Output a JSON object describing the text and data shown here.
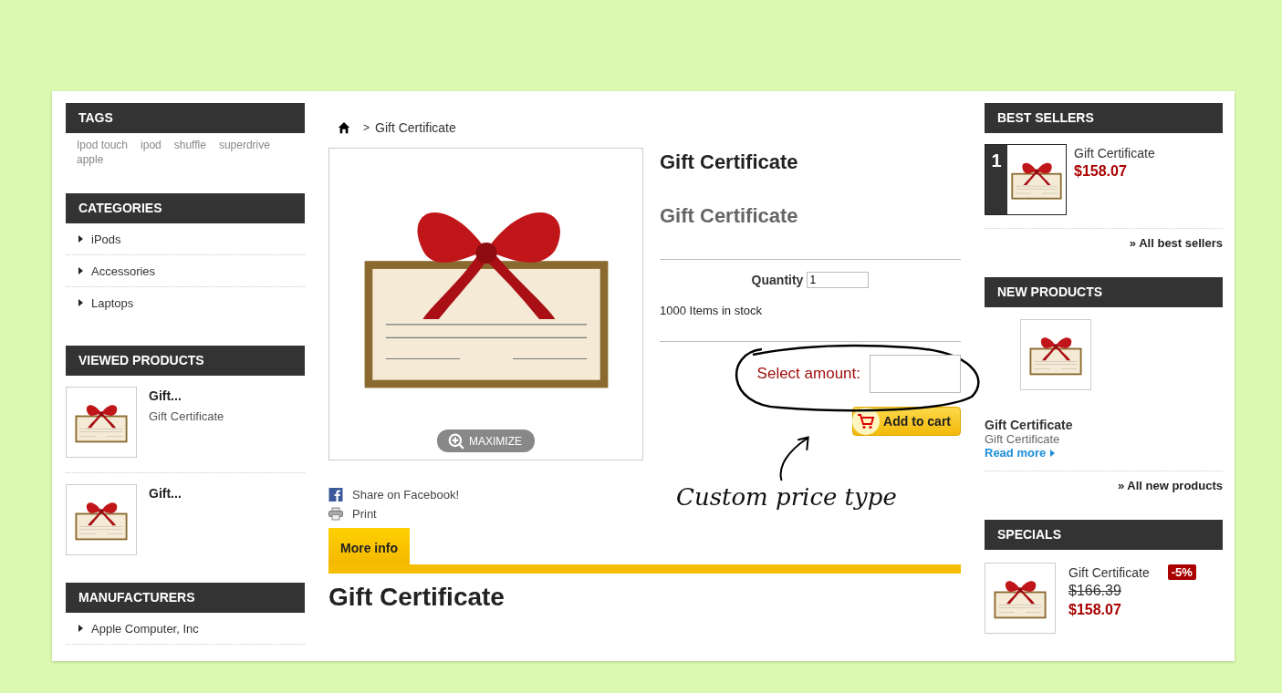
{
  "tags": {
    "title": "TAGS",
    "items": [
      "Ipod touch",
      "ipod",
      "shuffle",
      "superdrive",
      "apple"
    ]
  },
  "categories": {
    "title": "CATEGORIES",
    "items": [
      "iPods",
      "Accessories",
      "Laptops"
    ]
  },
  "viewed_products": {
    "title": "VIEWED PRODUCTS",
    "items": [
      {
        "name": "Gift...",
        "description": "Gift Certificate"
      },
      {
        "name": "Gift..."
      }
    ]
  },
  "manufacturers": {
    "title": "MANUFACTURERS",
    "items": [
      "Apple Computer, Inc"
    ]
  },
  "breadcrumb": {
    "separator": ">",
    "current": "Gift Certificate"
  },
  "product": {
    "title": "Gift Certificate",
    "subtitle": "Gift Certificate",
    "quantity_label": "Quantity",
    "quantity": "1",
    "stock": "1000 Items in stock",
    "amount_label": "Select amount:",
    "add_to_cart": "Add to cart",
    "maximize": "MAXIMIZE",
    "share": "Share on Facebook!",
    "print": "Print"
  },
  "annotation": "Custom price type",
  "tabs": [
    {
      "label": "More info",
      "selected": true
    }
  ],
  "description_title": "Gift Certificate",
  "best_sellers": {
    "title": "BEST SELLERS",
    "items": [
      {
        "rank": "1",
        "name": "Gift Certificate",
        "price": "$158.07"
      }
    ],
    "all_link": "» All best sellers"
  },
  "new_products": {
    "title": "NEW PRODUCTS",
    "items": [
      {
        "name": "Gift Certificate",
        "description": "Gift Certificate",
        "read_more": "Read more"
      }
    ],
    "all_link": "» All new products"
  },
  "specials": {
    "title": "SPECIALS",
    "items": [
      {
        "name": "Gift Certificate",
        "discount": "-5%",
        "old_price": "$166.39",
        "price": "$158.07"
      }
    ]
  }
}
